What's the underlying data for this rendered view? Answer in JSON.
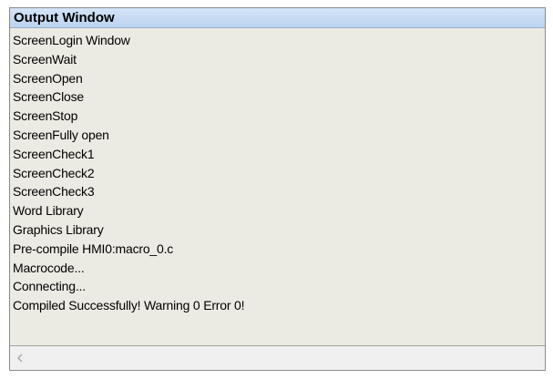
{
  "window": {
    "title": "Output Window"
  },
  "output": {
    "lines": [
      "ScreenLogin Window",
      "ScreenWait",
      "ScreenOpen",
      "ScreenClose",
      "ScreenStop",
      "ScreenFully open",
      "ScreenCheck1",
      "ScreenCheck2",
      "ScreenCheck3",
      "Word Library",
      "Graphics Library",
      "Pre-compile HMI0:macro_0.c",
      "Macrocode...",
      "Connecting...",
      "Compiled Successfully! Warning 0 Error 0!"
    ]
  },
  "scrollbar": {
    "left_arrow_icon": "chevron-left-icon"
  },
  "colors": {
    "titlebar": "#c7dcf4",
    "content_bg": "#ecebe3",
    "text": "#000000"
  }
}
